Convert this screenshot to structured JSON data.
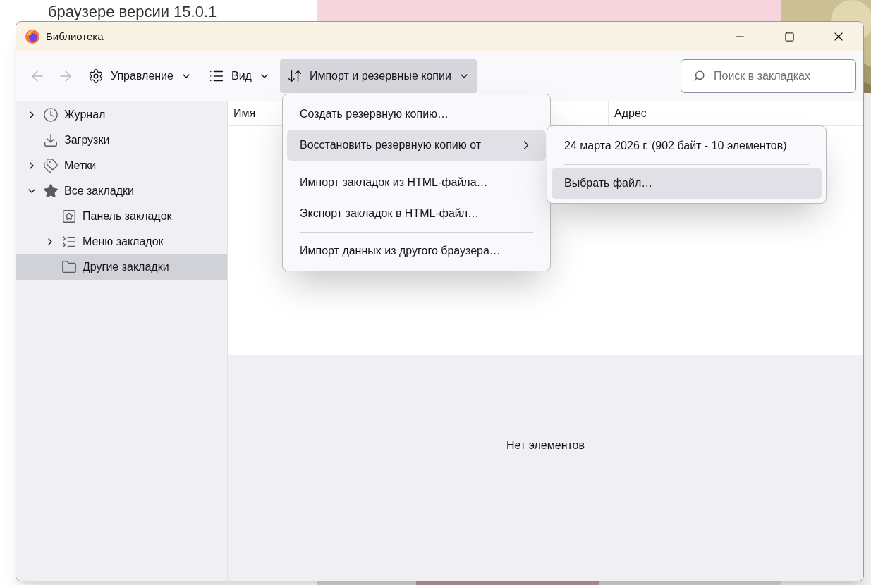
{
  "background": {
    "heading": "браузере версии 15.0.1"
  },
  "window": {
    "title": "Библиотека"
  },
  "nav_buttons": [
    {
      "kind": "back",
      "disabled": true
    },
    {
      "kind": "forward",
      "disabled": true
    }
  ],
  "toolbar_menus": [
    {
      "kind": "gear",
      "label": "Управление",
      "selected": false
    },
    {
      "kind": "list",
      "label": "Вид",
      "selected": false
    },
    {
      "kind": "sort",
      "label": "Импорт и резервные копии",
      "selected": true
    }
  ],
  "search": {
    "placeholder": "Поиск в закладках"
  },
  "sidebar": {
    "items": [
      {
        "kind": "clock",
        "label": "Журнал",
        "expanded": false,
        "selected": false
      },
      {
        "kind": "download",
        "label": "Загрузки",
        "selected": false
      },
      {
        "kind": "tag",
        "label": "Метки",
        "expanded": false,
        "selected": false
      },
      {
        "kind": "star",
        "label": "Все закладки",
        "expanded": true,
        "selected": false,
        "children": [
          {
            "kind": "toolbar",
            "label": "Панель закладок",
            "selected": false
          },
          {
            "kind": "menu",
            "label": "Меню закладок",
            "expanded": false,
            "selected": false
          },
          {
            "kind": "folder",
            "label": "Другие закладки",
            "selected": true
          }
        ]
      }
    ]
  },
  "table": {
    "columns": [
      "Имя",
      "Адрес"
    ]
  },
  "details": {
    "empty_text": "Нет элементов"
  },
  "menu": {
    "items": [
      {
        "kind": "item",
        "label": "Создать резервную копию…",
        "selected": false
      },
      {
        "kind": "submenu",
        "label": "Восстановить резервную копию от",
        "selected": true
      },
      {
        "kind": "separator"
      },
      {
        "kind": "item",
        "label": "Импорт закладок из HTML-файла…",
        "selected": false
      },
      {
        "kind": "item",
        "label": "Экспорт закладок в HTML-файл…",
        "selected": false
      },
      {
        "kind": "separator"
      },
      {
        "kind": "item",
        "label": "Импорт данных из другого браузера…",
        "selected": false
      }
    ]
  },
  "submenu": {
    "items": [
      {
        "kind": "item",
        "label": "24 марта 2026 г. (902 байт - 10 элементов)",
        "selected": false
      },
      {
        "kind": "separator"
      },
      {
        "kind": "item",
        "label": "Выбрать файл…",
        "selected": true
      }
    ]
  }
}
